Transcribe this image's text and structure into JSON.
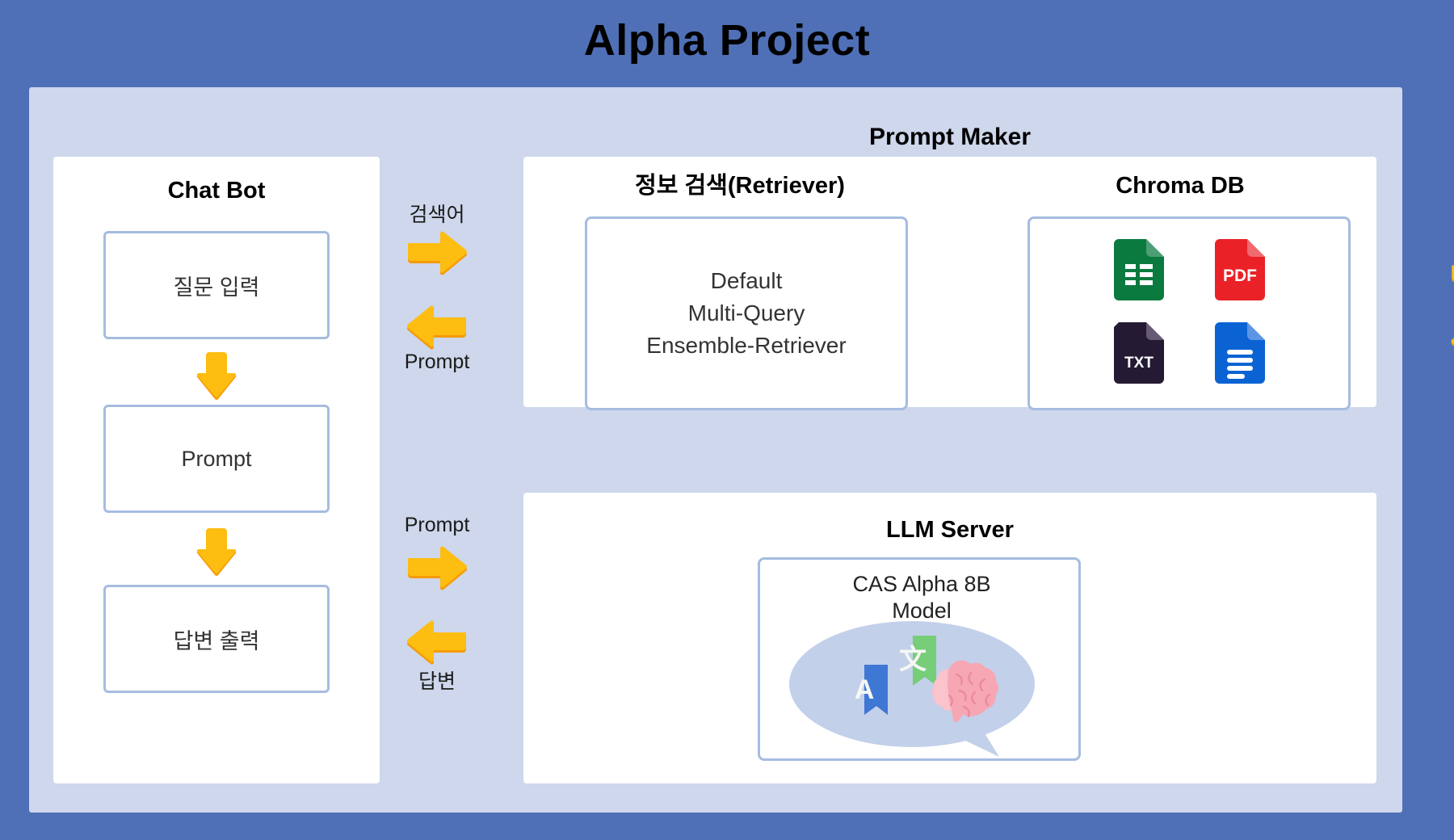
{
  "title": "Alpha Project",
  "colors": {
    "background": "#4f70b7",
    "panel": "#ced7eb",
    "card": "#ffffff",
    "border": "#a6bce0",
    "arrow": "#fdbd11",
    "arrow_shadow": "#f79a06"
  },
  "prompt_maker": {
    "label": "Prompt Maker"
  },
  "chatbot": {
    "title": "Chat Bot",
    "boxes": [
      {
        "label": "질문 입력"
      },
      {
        "label": "Prompt"
      },
      {
        "label": "답변 출력"
      }
    ],
    "arrows": [
      {
        "name": "down-arrow-1",
        "direction": "down"
      },
      {
        "name": "down-arrow-2",
        "direction": "down"
      }
    ]
  },
  "flow": {
    "groups": [
      {
        "name": "retriever-flow",
        "items": [
          {
            "label": "검색어",
            "label_position": "above",
            "direction": "right"
          },
          {
            "label": "Prompt",
            "label_position": "below",
            "direction": "left"
          }
        ]
      },
      {
        "name": "llm-flow",
        "items": [
          {
            "label": "Prompt",
            "label_position": "above",
            "direction": "right"
          },
          {
            "label": "답변",
            "label_position": "below",
            "direction": "left"
          }
        ]
      }
    ]
  },
  "retriever": {
    "title": "정보 검색(Retriever)",
    "options": [
      "Default",
      "Multi-Query",
      "Ensemble-Retriever"
    ]
  },
  "chroma": {
    "title": "Chroma DB",
    "files": [
      {
        "name": "spreadsheet-file-icon",
        "type": "spreadsheet",
        "label": "",
        "color": "#0b7a3f"
      },
      {
        "name": "pdf-file-icon",
        "type": "pdf",
        "label": "PDF",
        "color": "#ea2127"
      },
      {
        "name": "txt-file-icon",
        "type": "txt",
        "label": "TXT",
        "color": "#241a33"
      },
      {
        "name": "doc-file-icon",
        "type": "doc",
        "label": "",
        "color": "#0b63d3"
      }
    ]
  },
  "exchange_arrows": {
    "right": {
      "name": "retriever-to-chroma-arrow",
      "direction": "right"
    },
    "left": {
      "name": "chroma-to-retriever-arrow",
      "direction": "left"
    }
  },
  "llm": {
    "title": "LLM Server",
    "model_line1": "CAS Alpha 8B",
    "model_line2": "Model",
    "illustration": {
      "name": "speech-bubble-illustration",
      "translate_letter_latin": "A",
      "translate_letter_cjk": "文"
    }
  }
}
